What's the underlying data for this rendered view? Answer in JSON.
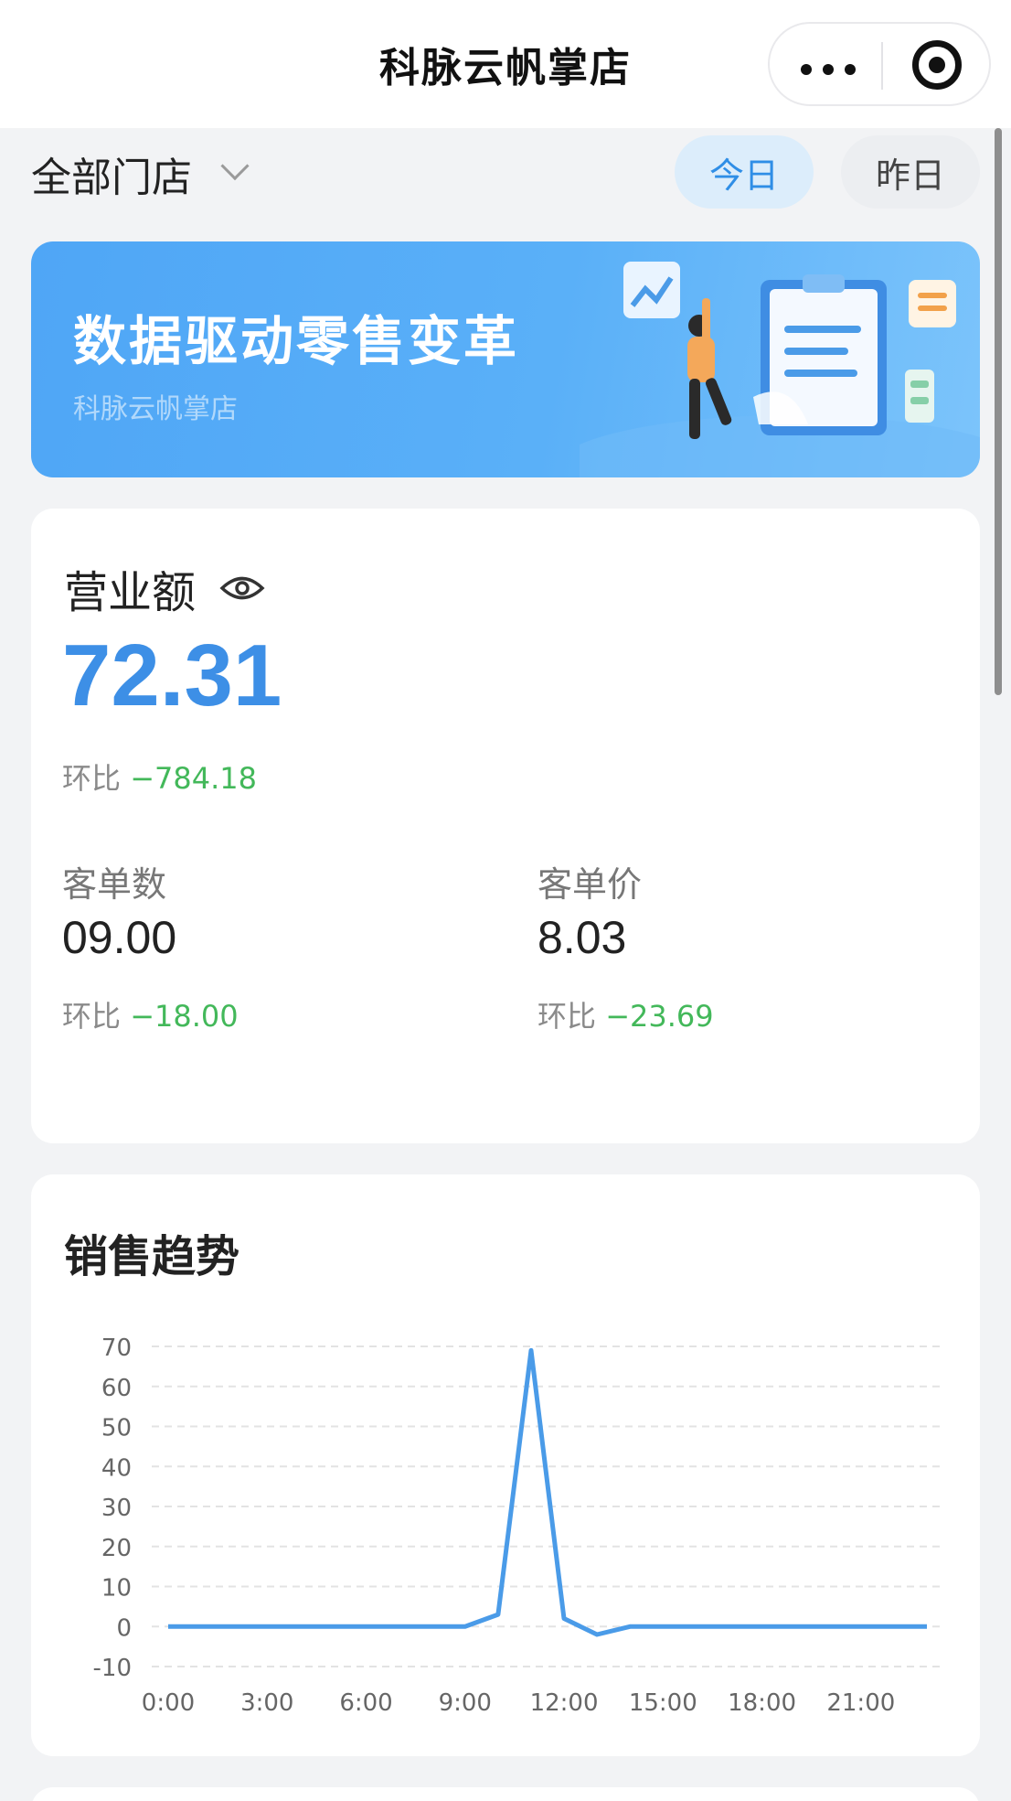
{
  "header": {
    "title": "科脉云帆掌店"
  },
  "filter": {
    "store_label": "全部门店",
    "tabs": [
      "今日",
      "昨日"
    ],
    "selected_tab": "今日"
  },
  "banner": {
    "title": "数据驱动零售变革",
    "subtitle": "科脉云帆掌店"
  },
  "revenue": {
    "title": "营业额",
    "value": "72.31",
    "ratio_label": "环比",
    "ratio_value": "−784.18"
  },
  "metrics": [
    {
      "label": "客单数",
      "value": "09.00",
      "ratio_label": "环比",
      "ratio_value": "−18.00"
    },
    {
      "label": "客单价",
      "value": "8.03",
      "ratio_label": "环比",
      "ratio_value": "−23.69"
    }
  ],
  "trend": {
    "title": "销售趋势",
    "chart_data": {
      "type": "line",
      "x": [
        "0:00",
        "1:00",
        "2:00",
        "3:00",
        "4:00",
        "5:00",
        "6:00",
        "7:00",
        "8:00",
        "9:00",
        "10:00",
        "11:00",
        "12:00",
        "13:00",
        "14:00",
        "15:00",
        "16:00",
        "17:00",
        "18:00",
        "19:00",
        "20:00",
        "21:00",
        "22:00",
        "23:00"
      ],
      "x_tick_labels": [
        "0:00",
        "3:00",
        "6:00",
        "9:00",
        "12:00",
        "15:00",
        "18:00",
        "21:00"
      ],
      "values": [
        0,
        0,
        0,
        0,
        0,
        0,
        0,
        0,
        0,
        0,
        3,
        69,
        2,
        -2,
        0,
        0,
        0,
        0,
        0,
        0,
        0,
        0,
        0,
        0
      ],
      "y_ticks": [
        70,
        60,
        50,
        40,
        30,
        20,
        10,
        0,
        -10
      ],
      "ylim": [
        -10,
        70
      ],
      "grid": true,
      "line_color": "#4a9be8"
    }
  },
  "colors": {
    "accent": "#3d8fe6",
    "negative": "#43b85a",
    "banner": "#55acf7"
  }
}
